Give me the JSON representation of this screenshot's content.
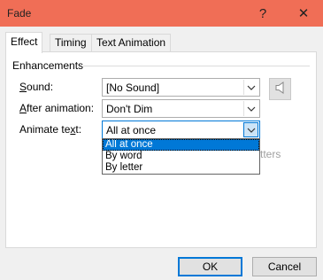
{
  "window": {
    "title": "Fade"
  },
  "titlebar_buttons": {
    "help": "?",
    "close": "✕"
  },
  "tabs": [
    {
      "label": "Effect",
      "active": true
    },
    {
      "label": "Timing",
      "active": false
    },
    {
      "label": "Text Animation",
      "active": false
    }
  ],
  "enhancements": {
    "group_label": "Enhancements",
    "sound": {
      "label_access_key": "S",
      "label_rest": "ound:",
      "value": "[No Sound]"
    },
    "after_animation": {
      "label_access_key": "A",
      "label_rest": "fter animation:",
      "value": "Don't Dim"
    },
    "animate_text": {
      "label_pre": "Animate te",
      "label_access_key": "x",
      "label_rest": "t:",
      "value": "All at once"
    }
  },
  "dropdown_options": [
    {
      "label": "All at once",
      "selected": true
    },
    {
      "label": "By word",
      "selected": false
    },
    {
      "label": "By letter",
      "selected": false
    }
  ],
  "hidden_text_fragment": "tters",
  "buttons": {
    "ok": "OK",
    "cancel": "Cancel"
  },
  "colors": {
    "titlebar": "#f06e56",
    "accent": "#0078d7",
    "selection": "#0078d7"
  }
}
